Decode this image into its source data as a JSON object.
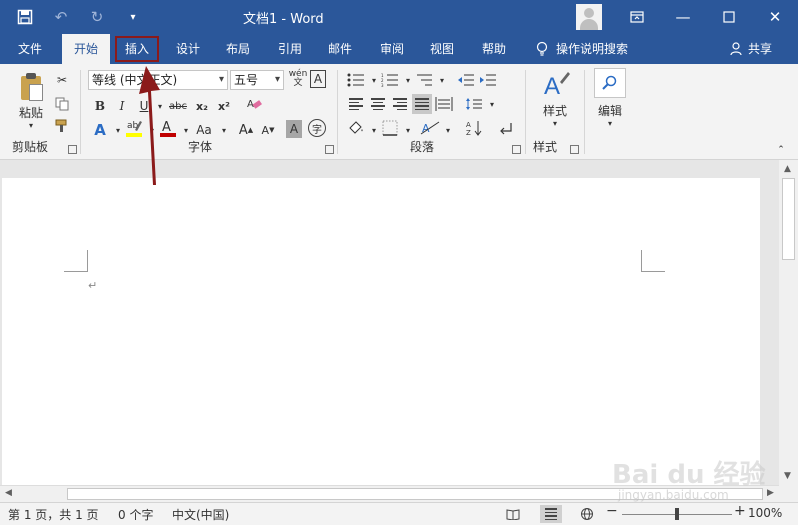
{
  "window": {
    "title": "文档1  -  Word",
    "controls": [
      "restore-ribbon-icon",
      "minimize-icon",
      "maximize-icon",
      "close-icon"
    ]
  },
  "qat": {
    "save": "save-icon",
    "undo": "undo-icon",
    "redo": "redo-icon",
    "customize": "customize-qat-icon"
  },
  "tabs": [
    {
      "label": "文件"
    },
    {
      "label": "开始",
      "active": true
    },
    {
      "label": "插入",
      "highlighted": true
    },
    {
      "label": "设计"
    },
    {
      "label": "布局"
    },
    {
      "label": "引用"
    },
    {
      "label": "邮件"
    },
    {
      "label": "审阅"
    },
    {
      "label": "视图"
    },
    {
      "label": "帮助"
    }
  ],
  "tell_me": "操作说明搜索",
  "share": "共享",
  "ribbon": {
    "clipboard": {
      "paste_label": "粘贴",
      "group_label": "剪贴板"
    },
    "font": {
      "font_name": "等线 (中文正文)",
      "font_size": "五号",
      "group_label": "字体",
      "bold": "B",
      "italic": "I",
      "strike": "abc",
      "subscript": "x₂",
      "superscript": "x²",
      "font_color": "A",
      "char_shade": "A",
      "change_case": "Aa",
      "grow": "A",
      "shrink": "A",
      "phonetic_top": "wén",
      "phonetic_bottom": "文"
    },
    "paragraph": {
      "group_label": "段落"
    },
    "styles": {
      "label": "样式",
      "group_label": "样式"
    },
    "editing": {
      "label": "编辑"
    }
  },
  "document": {
    "paragraph_mark": "↵"
  },
  "status": {
    "page": "第 1 页，共 1 页",
    "words": "0 个字",
    "language": "中文(中国)",
    "zoom": "100%",
    "zoom_level": 100
  },
  "watermark": {
    "main": "Bai du 经验",
    "sub": "jingyan.baidu.com"
  },
  "colors": {
    "accent": "#2b579a",
    "highlight_box": "#8b1a1a"
  }
}
